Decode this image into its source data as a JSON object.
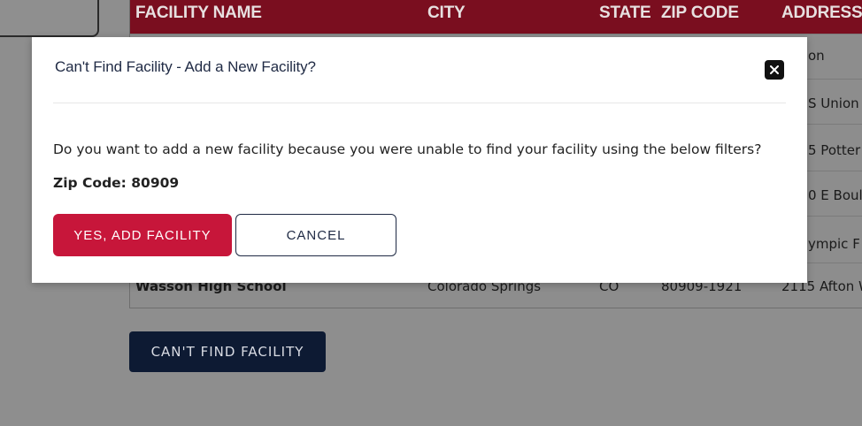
{
  "table": {
    "columns": [
      "FACILITY NAME",
      "CITY",
      "STATE",
      "ZIP CODE",
      "ADDRESS"
    ],
    "address_fragments": [
      "on",
      "S Union",
      "5 Potter",
      "0 E Boul",
      "ympic F"
    ],
    "last_row": {
      "name": "Wasson High School",
      "city": "Colorado Springs",
      "state": "CO",
      "zip": "80909-1921",
      "address": "2115 Afton W"
    }
  },
  "cant_find_button": "CAN'T FIND FACILITY",
  "modal": {
    "title": "Can't Find Facility - Add a New Facility?",
    "question": "Do you want to add a new facility because you were unable to find your facility using the below filters?",
    "zip_line": "Zip Code: 80909",
    "yes_label": "YES, ADD FACILITY",
    "cancel_label": "CANCEL",
    "close_icon": "close-icon"
  },
  "colors": {
    "header": "#7a0e1f",
    "primary": "#c7163a",
    "navy": "#0d1a33",
    "overlay": "#8e8e8e"
  }
}
